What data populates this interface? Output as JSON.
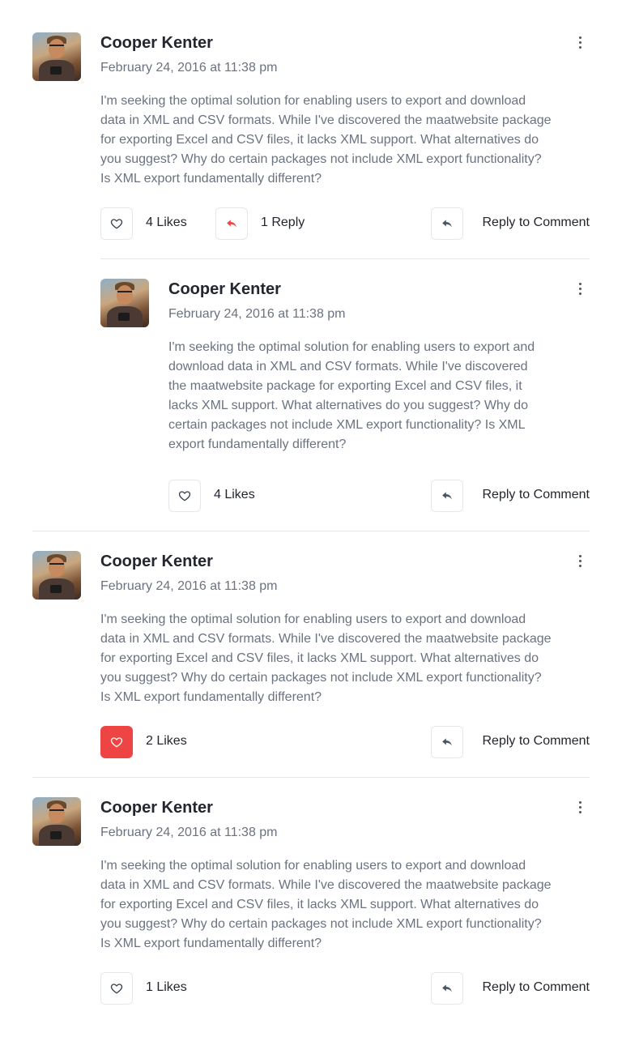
{
  "comments": [
    {
      "author": "Cooper Kenter",
      "date": "February 24, 2016 at 11:38 pm",
      "text": "I'm seeking the optimal solution for enabling users to export and download data in XML and CSV formats. While I've discovered the maatwebsite package for exporting Excel and CSV files, it lacks XML support. What alternatives do you suggest? Why do certain packages not include XML export functionality? Is XML export fundamentally different?",
      "likes_label": "4 Likes",
      "replies_label": "1 Reply",
      "reply_to_label": "Reply to Comment",
      "liked": false
    },
    {
      "author": "Cooper Kenter",
      "date": "February 24, 2016 at 11:38 pm",
      "text": "I'm seeking the optimal solution for enabling users to export and download data in XML and CSV formats. While I've discovered the maatwebsite package for exporting Excel and CSV files, it lacks XML support. What alternatives do you suggest? Why do certain packages not include XML export functionality? Is XML export fundamentally different?",
      "likes_label": "4 Likes",
      "reply_to_label": "Reply to Comment",
      "liked": false
    },
    {
      "author": "Cooper Kenter",
      "date": "February 24, 2016 at 11:38 pm",
      "text": "I'm seeking the optimal solution for enabling users to export and download data in XML and CSV formats. While I've discovered the maatwebsite package for exporting Excel and CSV files, it lacks XML support. What alternatives do you suggest? Why do certain packages not include XML export functionality? Is XML export fundamentally different?",
      "likes_label": "2 Likes",
      "reply_to_label": "Reply to Comment",
      "liked": true
    },
    {
      "author": "Cooper Kenter",
      "date": "February 24, 2016 at 11:38 pm",
      "text": "I'm seeking the optimal solution for enabling users to export and download data in XML and CSV formats. While I've discovered the maatwebsite package for exporting Excel and CSV files, it lacks XML support. What alternatives do you suggest? Why do certain packages not include XML export functionality? Is XML export fundamentally different?",
      "likes_label": "1 Likes",
      "reply_to_label": "Reply to Comment",
      "liked": false
    }
  ],
  "colors": {
    "accent": "#ef4444",
    "text": "#23262f",
    "muted": "#6b7280",
    "border": "#e5e7eb"
  },
  "icons": {
    "like": "heart-icon",
    "replies": "reply-arrow-icon",
    "reply_to": "reply-arrow-icon",
    "more": "more-vertical-icon"
  }
}
